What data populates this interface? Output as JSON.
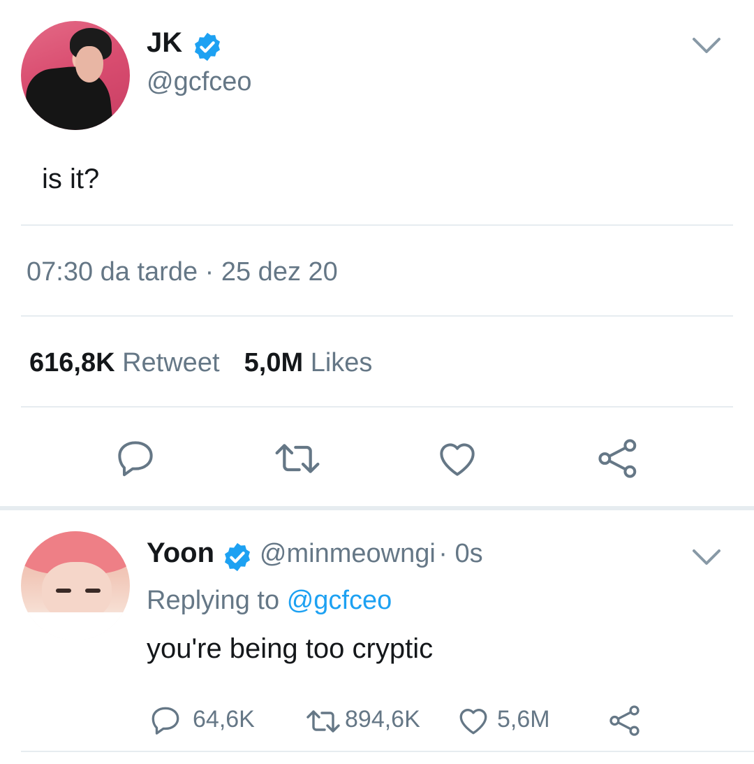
{
  "tweet": {
    "author_name": "JK",
    "author_handle": "@gcfceo",
    "text": "is it?",
    "timestamp": "07:30 da tarde · 25 dez 20",
    "retweets_count": "616,8K",
    "retweets_label": "Retweet",
    "likes_count": "5,0M",
    "likes_label": "Likes",
    "verified": true,
    "icons": [
      "reply-icon",
      "retweet-icon",
      "like-icon",
      "share-icon"
    ]
  },
  "reply": {
    "author_name": "Yoon",
    "author_handle": "@minmeowngi",
    "time": "· 0s",
    "replying_prefix": "Replying to",
    "replying_handle": "@gcfceo",
    "text": "you're being too cryptic",
    "reply_count": "64,6K",
    "retweet_count": "894,6K",
    "like_count": "5,6M",
    "verified": true
  },
  "colors": {
    "text": "#14171a",
    "secondary": "#657786",
    "link": "#1da1f2",
    "verified": "#1da1f2",
    "divider": "#e6ecf0"
  }
}
